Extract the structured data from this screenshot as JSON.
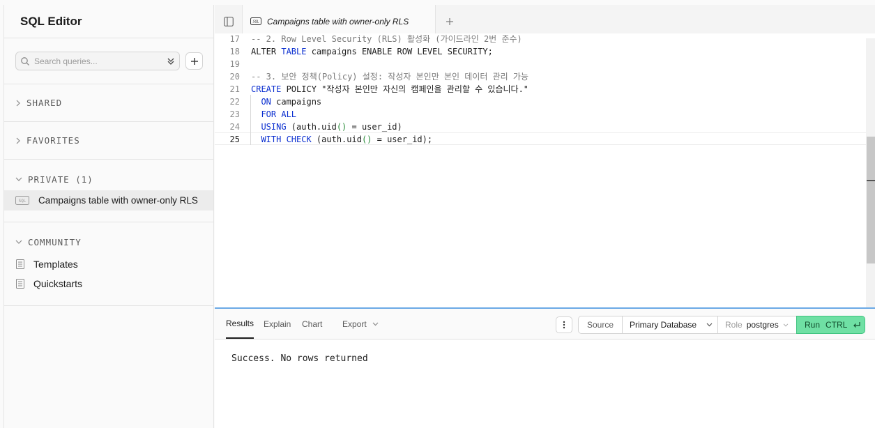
{
  "sidebar": {
    "title": "SQL Editor",
    "search_placeholder": "Search queries...",
    "sections": {
      "shared": "SHARED",
      "favorites": "FAVORITES",
      "private": "PRIVATE (1)",
      "community": "COMMUNITY"
    },
    "private_items": [
      {
        "badge": "SQL",
        "label": "Campaigns table with owner-only RLS"
      }
    ],
    "community_items": [
      {
        "label": "Templates"
      },
      {
        "label": "Quickstarts"
      }
    ]
  },
  "tabs": [
    {
      "badge": "SQL",
      "label": "Campaigns table with owner-only RLS"
    }
  ],
  "editor": {
    "active_line": "25",
    "lines": [
      {
        "n": "17",
        "text": "-- 2. Row Level Security (RLS) 활성화 (가이드라인 2번 준수)"
      },
      {
        "n": "18",
        "text": "ALTER TABLE campaigns ENABLE ROW LEVEL SECURITY;"
      },
      {
        "n": "19",
        "text": ""
      },
      {
        "n": "20",
        "text": "-- 3. 보안 정책(Policy) 설정: 작성자 본인만 본인 데이터 관리 가능"
      },
      {
        "n": "21",
        "text": "CREATE POLICY \"작성자 본인만 자신의 캠페인을 관리할 수 있습니다.\""
      },
      {
        "n": "22",
        "text": "  ON campaigns"
      },
      {
        "n": "23",
        "text": "  FOR ALL"
      },
      {
        "n": "24",
        "text": "  USING (auth.uid() = user_id)"
      },
      {
        "n": "25",
        "text": "  WITH CHECK (auth.uid() = user_id);"
      }
    ]
  },
  "results": {
    "tabs": [
      "Results",
      "Explain",
      "Chart"
    ],
    "active_tab": "Results",
    "export_label": "Export",
    "source_label": "Source",
    "database": "Primary Database",
    "role_label": "Role",
    "role_value": "postgres",
    "run_label": "Run",
    "run_shortcut": "CTRL",
    "output": "Success. No rows returned"
  },
  "colors": {
    "keyword": "#0b2fd0",
    "comment": "#7a7a7a",
    "paren": "#2a8c3a",
    "run_button": "#6fe0a4",
    "divider": "#6aa9e6"
  }
}
